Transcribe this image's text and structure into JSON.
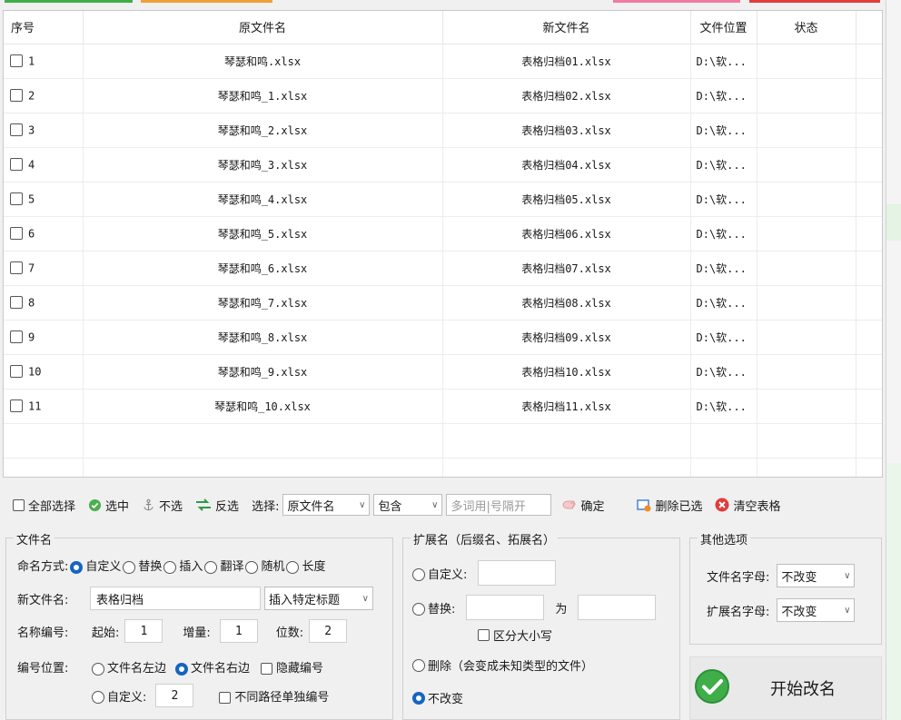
{
  "table": {
    "headers": {
      "idx": "序号",
      "orig": "原文件名",
      "new": "新文件名",
      "loc": "文件位置",
      "status": "状态"
    },
    "rows": [
      {
        "idx": "1",
        "orig": "琴瑟和鸣.xlsx",
        "new": "表格归档01.xlsx",
        "loc": "D:\\软...",
        "status": ""
      },
      {
        "idx": "2",
        "orig": "琴瑟和鸣_1.xlsx",
        "new": "表格归档02.xlsx",
        "loc": "D:\\软...",
        "status": ""
      },
      {
        "idx": "3",
        "orig": "琴瑟和鸣_2.xlsx",
        "new": "表格归档03.xlsx",
        "loc": "D:\\软...",
        "status": ""
      },
      {
        "idx": "4",
        "orig": "琴瑟和鸣_3.xlsx",
        "new": "表格归档04.xlsx",
        "loc": "D:\\软...",
        "status": ""
      },
      {
        "idx": "5",
        "orig": "琴瑟和鸣_4.xlsx",
        "new": "表格归档05.xlsx",
        "loc": "D:\\软...",
        "status": ""
      },
      {
        "idx": "6",
        "orig": "琴瑟和鸣_5.xlsx",
        "new": "表格归档06.xlsx",
        "loc": "D:\\软...",
        "status": ""
      },
      {
        "idx": "7",
        "orig": "琴瑟和鸣_6.xlsx",
        "new": "表格归档07.xlsx",
        "loc": "D:\\软...",
        "status": ""
      },
      {
        "idx": "8",
        "orig": "琴瑟和鸣_7.xlsx",
        "new": "表格归档08.xlsx",
        "loc": "D:\\软...",
        "status": ""
      },
      {
        "idx": "9",
        "orig": "琴瑟和鸣_8.xlsx",
        "new": "表格归档09.xlsx",
        "loc": "D:\\软...",
        "status": ""
      },
      {
        "idx": "10",
        "orig": "琴瑟和鸣_9.xlsx",
        "new": "表格归档10.xlsx",
        "loc": "D:\\软...",
        "status": ""
      },
      {
        "idx": "11",
        "orig": "琴瑟和鸣_10.xlsx",
        "new": "表格归档11.xlsx",
        "loc": "D:\\软...",
        "status": ""
      }
    ]
  },
  "toolbar": {
    "select_all": "全部选择",
    "select": "选中",
    "deselect": "不选",
    "invert": "反选",
    "choose_label": "选择:",
    "field_value": "原文件名",
    "match_value": "包含",
    "keyword_placeholder": "多词用|号隔开",
    "confirm": "确定",
    "delete_selected": "删除已选",
    "clear_table": "清空表格"
  },
  "filename_group": {
    "title": "文件名",
    "mode_label": "命名方式:",
    "modes": [
      "自定义",
      "替换",
      "插入",
      "翻译",
      "随机",
      "长度"
    ],
    "mode_selected": "自定义",
    "new_name_label": "新文件名:",
    "new_name_value": "表格归档",
    "insert_title_select": "插入特定标题",
    "number_label": "名称编号:",
    "start_label": "起始:",
    "start_value": "1",
    "step_label": "增量:",
    "step_value": "1",
    "digits_label": "位数:",
    "digits_value": "2",
    "position_label": "编号位置:",
    "pos_left": "文件名左边",
    "pos_right": "文件名右边",
    "hide_number": "隐藏编号",
    "pos_custom": "自定义:",
    "pos_custom_value": "2",
    "separate_path": "不同路径单独编号"
  },
  "ext_group": {
    "title": "扩展名（后缀名、拓展名）",
    "custom": "自定义:",
    "replace": "替换:",
    "to": "为",
    "case_sensitive": "区分大小写",
    "delete": "删除（会变成未知类型的文件）",
    "unchanged": "不改变"
  },
  "other_group": {
    "title": "其他选项",
    "filename_case_label": "文件名字母:",
    "filename_case_value": "不改变",
    "ext_case_label": "扩展名字母:",
    "ext_case_value": "不改变"
  },
  "start_button": "开始改名",
  "colors": {
    "accent": "#1565c0",
    "green": "#3fae49",
    "red": "#e23b3b"
  }
}
